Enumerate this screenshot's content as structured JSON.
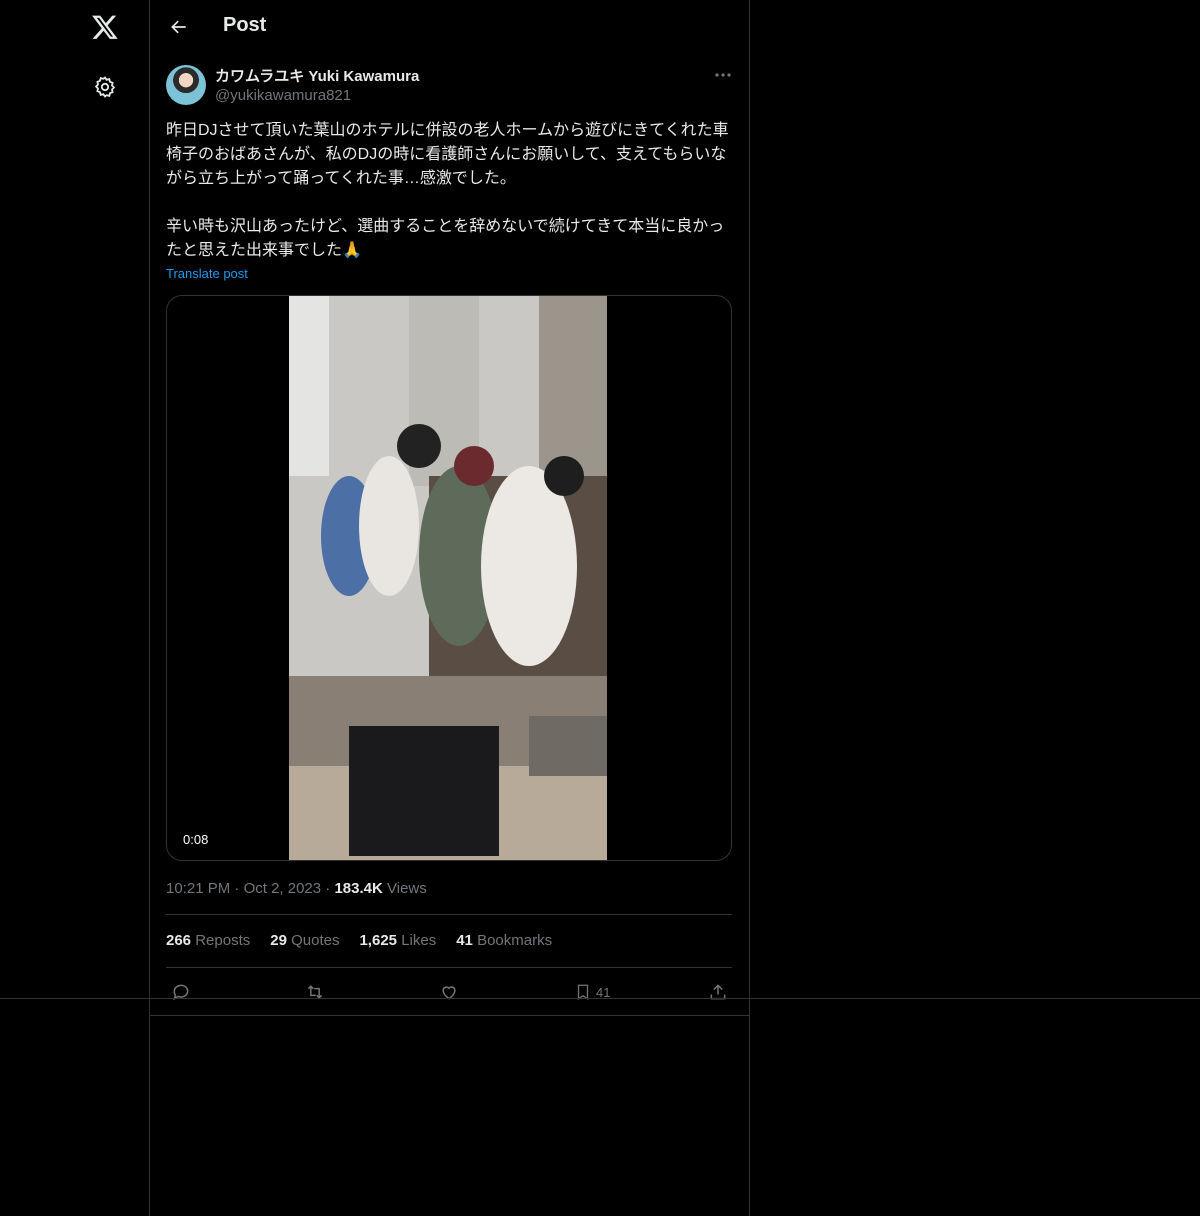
{
  "header": {
    "title": "Post"
  },
  "author": {
    "display_name": "カワムラユキ Yuki Kawamura",
    "handle": "@yukikawamura821"
  },
  "post": {
    "text": "昨日DJさせて頂いた葉山のホテルに併設の老人ホームから遊びにきてくれた車椅子のおばあさんが、私のDJの時に看護師さんにお願いして、支えてもらいながら立ち上がって踊ってくれた事…感激でした。\n\n辛い時も沢山あったけど、選曲することを辞めないで続けてきて本当に良かったと思えた出来事でした🙏",
    "translate_label": "Translate post",
    "video_duration": "0:08",
    "time": "10:21 PM",
    "date": "Oct 2, 2023",
    "views_count": "183.4K",
    "views_label": "Views"
  },
  "stats": {
    "reposts_count": "266",
    "reposts_label": "Reposts",
    "quotes_count": "29",
    "quotes_label": "Quotes",
    "likes_count": "1,625",
    "likes_label": "Likes",
    "bookmarks_count": "41",
    "bookmarks_label": "Bookmarks"
  },
  "actions": {
    "bookmark_count": "41"
  },
  "colors": {
    "accent": "#1d9bf0",
    "muted": "#71767b",
    "text": "#e7e9ea",
    "border": "#2f3336",
    "background": "#000000"
  },
  "icons": [
    "x-logo-icon",
    "gear-icon",
    "back-arrow-icon",
    "more-icon",
    "reply-icon",
    "repost-icon",
    "like-icon",
    "bookmark-icon",
    "share-icon"
  ]
}
